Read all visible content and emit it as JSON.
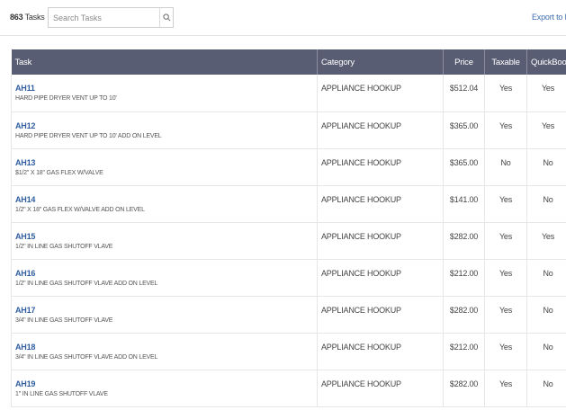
{
  "header": {
    "task_count": "863",
    "task_count_label": "Tasks",
    "search_placeholder": "Search Tasks",
    "export_label": "Export to Exc"
  },
  "table": {
    "columns": [
      "Task",
      "Category",
      "Price",
      "Taxable",
      "QuickBooks"
    ],
    "rows": [
      {
        "code": "AH11",
        "desc": "HARD PIPE DRYER VENT UP TO 10'",
        "category": "APPLIANCE HOOKUP",
        "price": "$512.04",
        "taxable": "Yes",
        "quickbooks": "Yes"
      },
      {
        "code": "AH12",
        "desc": "HARD PIPE DRYER VENT UP TO 10' ADD ON LEVEL",
        "category": "APPLIANCE HOOKUP",
        "price": "$365.00",
        "taxable": "Yes",
        "quickbooks": "Yes"
      },
      {
        "code": "AH13",
        "desc": "$1/2\" X 18\" GAS FLEX W/VALVE",
        "category": "APPLIANCE HOOKUP",
        "price": "$365.00",
        "taxable": "No",
        "quickbooks": "No"
      },
      {
        "code": "AH14",
        "desc": "1/2\" X 18\" GAS FLEX W/VALVE ADD ON LEVEL",
        "category": "APPLIANCE HOOKUP",
        "price": "$141.00",
        "taxable": "Yes",
        "quickbooks": "No"
      },
      {
        "code": "AH15",
        "desc": "1/2\" IN LINE GAS SHUTOFF VLAVE",
        "category": "APPLIANCE HOOKUP",
        "price": "$282.00",
        "taxable": "Yes",
        "quickbooks": "Yes"
      },
      {
        "code": "AH16",
        "desc": "1/2\" IN LINE GAS SHUTOFF VLAVE ADD ON LEVEL",
        "category": "APPLIANCE HOOKUP",
        "price": "$212.00",
        "taxable": "Yes",
        "quickbooks": "No"
      },
      {
        "code": "AH17",
        "desc": "3/4\" IN LINE GAS SHUTOFF VLAVE",
        "category": "APPLIANCE HOOKUP",
        "price": "$282.00",
        "taxable": "Yes",
        "quickbooks": "No"
      },
      {
        "code": "AH18",
        "desc": "3/4\" IN LINE GAS SHUTOFF VLAVE ADD ON LEVEL",
        "category": "APPLIANCE HOOKUP",
        "price": "$212.00",
        "taxable": "Yes",
        "quickbooks": "No"
      },
      {
        "code": "AH19",
        "desc": "1\" IN LINE GAS SHUTOFF VLAVE",
        "category": "APPLIANCE HOOKUP",
        "price": "$282.00",
        "taxable": "Yes",
        "quickbooks": "No"
      }
    ]
  },
  "icons": {
    "search": "search-icon"
  },
  "colors": {
    "header_bg": "#595d73",
    "link": "#2f5da0",
    "export_link": "#3f6fb0"
  }
}
